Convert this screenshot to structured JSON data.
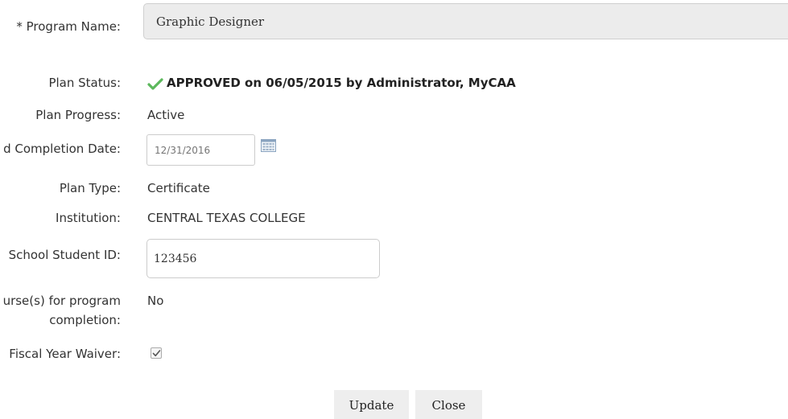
{
  "program_name": {
    "label": "* Program Name:",
    "value": "Graphic Designer"
  },
  "plan_status": {
    "label": "Plan Status:",
    "value": "APPROVED on 06/05/2015 by Administrator, MyCAA",
    "icon": "check-icon",
    "icon_color": "#5cb85c"
  },
  "plan_progress": {
    "label": "Plan Progress:",
    "value": "Active"
  },
  "completion_date": {
    "label": "d Completion Date:",
    "placeholder": "12/31/2016",
    "icon": "calendar-icon"
  },
  "plan_type": {
    "label": "Plan Type:",
    "value": "Certificate"
  },
  "institution": {
    "label": "Institution:",
    "value": "CENTRAL TEXAS COLLEGE"
  },
  "school_student_id": {
    "label": "School Student ID:",
    "value": "123456"
  },
  "courses_for_program": {
    "label_line1": "urse(s) for program",
    "label_line2": "completion:",
    "value": "No"
  },
  "fiscal_year_waiver": {
    "label": "Fiscal Year Waiver:",
    "checked": true
  },
  "buttons": {
    "update_label": "Update",
    "close_label": "Close"
  }
}
